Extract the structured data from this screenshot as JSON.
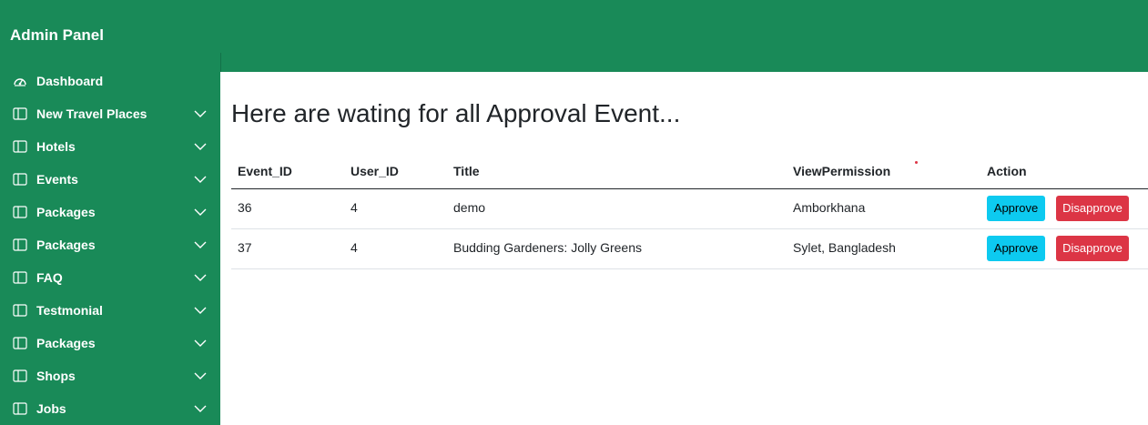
{
  "brand": "Admin Panel",
  "sidebar": {
    "items": [
      {
        "label": "Dashboard",
        "icon": "speedometer-icon",
        "has_chevron": false
      },
      {
        "label": "New Travel Places",
        "icon": "layout-icon",
        "has_chevron": true
      },
      {
        "label": "Hotels",
        "icon": "layout-icon",
        "has_chevron": true
      },
      {
        "label": "Events",
        "icon": "layout-icon",
        "has_chevron": true
      },
      {
        "label": "Packages",
        "icon": "layout-icon",
        "has_chevron": true
      },
      {
        "label": "Packages",
        "icon": "layout-icon",
        "has_chevron": true
      },
      {
        "label": "FAQ",
        "icon": "layout-icon",
        "has_chevron": true
      },
      {
        "label": "Testmonial",
        "icon": "layout-icon",
        "has_chevron": true
      },
      {
        "label": "Packages",
        "icon": "layout-icon",
        "has_chevron": true
      },
      {
        "label": "Shops",
        "icon": "layout-icon",
        "has_chevron": true
      },
      {
        "label": "Jobs",
        "icon": "layout-icon",
        "has_chevron": true
      }
    ]
  },
  "main": {
    "title": "Here are wating for all Approval Event...",
    "table": {
      "headers": [
        "Event_ID",
        "User_ID",
        "Title",
        "ViewPermission",
        "Action"
      ],
      "rows": [
        {
          "event_id": "36",
          "user_id": "4",
          "title": "demo",
          "view_permission": "Amborkhana",
          "approve": "Approve",
          "disapprove": "Disapprove"
        },
        {
          "event_id": "37",
          "user_id": "4",
          "title": "Budding Gardeners: Jolly Greens",
          "view_permission": "Sylet, Bangladesh",
          "approve": "Approve",
          "disapprove": "Disapprove"
        }
      ]
    }
  },
  "colors": {
    "brand_green": "#198a58",
    "approve": "#0dcaf0",
    "disapprove": "#dc3545"
  }
}
